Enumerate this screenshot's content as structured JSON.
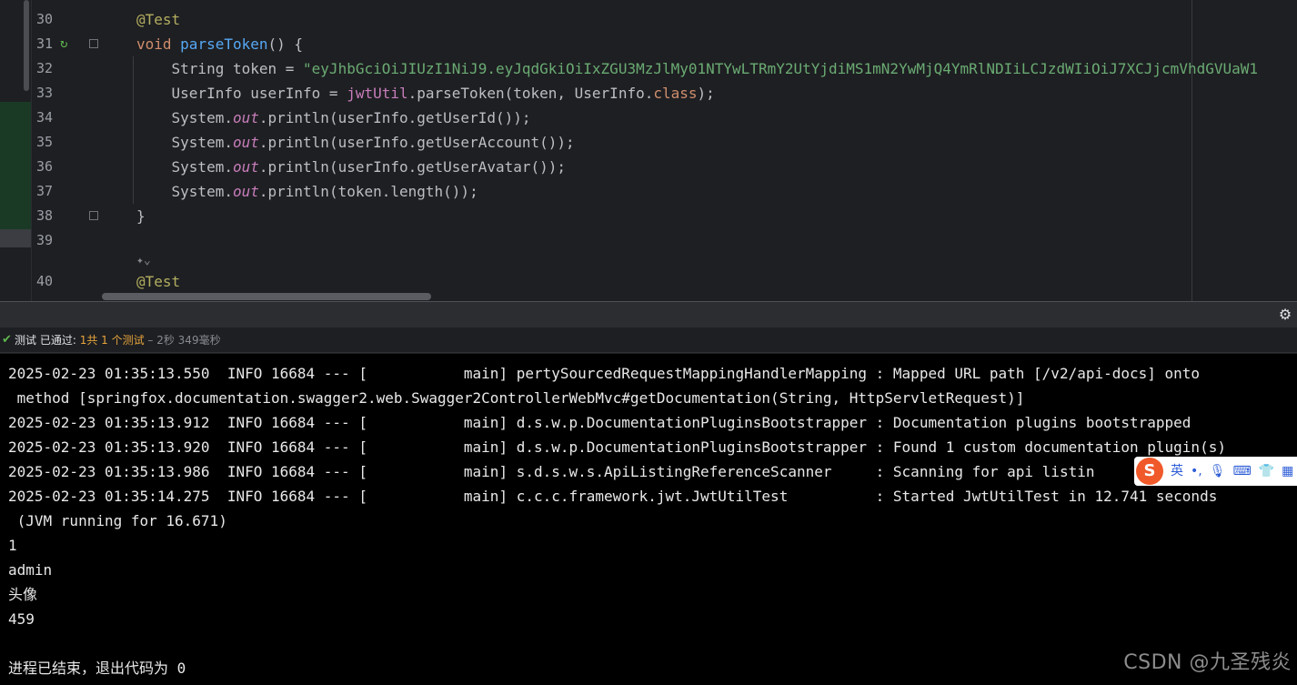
{
  "editor": {
    "line_numbers": [
      "30",
      "31",
      "32",
      "33",
      "34",
      "35",
      "36",
      "37",
      "38",
      "39",
      "40"
    ],
    "lines": [
      [
        {
          "c": "ann",
          "t": "@Test"
        }
      ],
      [
        {
          "c": "kw",
          "t": "void "
        },
        {
          "c": "fn",
          "t": "parseToken"
        },
        {
          "c": "pl",
          "t": "() {"
        }
      ],
      [
        {
          "c": "pl",
          "t": "    String token = "
        },
        {
          "c": "str",
          "t": "\"eyJhbGciOiJIUzI1NiJ9.eyJqdGkiOiIxZGU3MzJlMy01NTYwLTRmY2UtYjdiMS1mN2YwMjQ4YmRlNDIiLCJzdWIiOiJ7XCJjcmVhdGVUaW1"
        }
      ],
      [
        {
          "c": "pl",
          "t": "    UserInfo userInfo = "
        },
        {
          "c": "fld",
          "t": "jwtUtil"
        },
        {
          "c": "pl",
          "t": ".parseToken(token, UserInfo."
        },
        {
          "c": "kw",
          "t": "class"
        },
        {
          "c": "pl",
          "t": ");"
        }
      ],
      [
        {
          "c": "pl",
          "t": "    System."
        },
        {
          "c": "st",
          "t": "out"
        },
        {
          "c": "pl",
          "t": ".println(userInfo.getUserId());"
        }
      ],
      [
        {
          "c": "pl",
          "t": "    System."
        },
        {
          "c": "st",
          "t": "out"
        },
        {
          "c": "pl",
          "t": ".println(userInfo.getUserAccount());"
        }
      ],
      [
        {
          "c": "pl",
          "t": "    System."
        },
        {
          "c": "st",
          "t": "out"
        },
        {
          "c": "pl",
          "t": ".println(userInfo.getUserAvatar());"
        }
      ],
      [
        {
          "c": "pl",
          "t": "    System."
        },
        {
          "c": "st",
          "t": "out"
        },
        {
          "c": "pl",
          "t": ".println(token.length());"
        }
      ],
      [
        {
          "c": "pl",
          "t": "}"
        }
      ],
      [],
      [
        {
          "c": "ann",
          "t": "@Test"
        }
      ]
    ],
    "lens_hint": "✦⌄"
  },
  "toolbar": {
    "settings_icon": "⚙"
  },
  "status": {
    "check_icon": "✔",
    "label": "测试 已通过: ",
    "passed": "1",
    "total": "共 1 个测试",
    "duration": " – 2秒 349毫秒"
  },
  "console": {
    "lines": [
      "2025-02-23 01:35:13.550  INFO 16684 --- [           main] pertySourcedRequestMappingHandlerMapping : Mapped URL path [/v2/api-docs] onto",
      " method [springfox.documentation.swagger2.web.Swagger2ControllerWebMvc#getDocumentation(String, HttpServletRequest)]",
      "2025-02-23 01:35:13.912  INFO 16684 --- [           main] d.s.w.p.DocumentationPluginsBootstrapper : Documentation plugins bootstrapped",
      "2025-02-23 01:35:13.920  INFO 16684 --- [           main] d.s.w.p.DocumentationPluginsBootstrapper : Found 1 custom documentation plugin(s)",
      "2025-02-23 01:35:13.986  INFO 16684 --- [           main] s.d.s.w.s.ApiListingReferenceScanner     : Scanning for api listin",
      "2025-02-23 01:35:14.275  INFO 16684 --- [           main] c.c.c.framework.jwt.JwtUtilTest          : Started JwtUtilTest in 12.741 seconds",
      " (JVM running for 16.671)",
      "1",
      "admin",
      "头像",
      "459",
      "",
      "进程已结束，退出代码为 0"
    ]
  },
  "ime": {
    "logo": "S",
    "items": [
      "英",
      "•,",
      "🎙",
      "⌨",
      "👕",
      "▦"
    ]
  },
  "watermark": "CSDN @九圣残炎",
  "colors": {
    "editor_bg": "#1e1f22",
    "console_bg": "#000000",
    "annotation": "#b3ae60",
    "keyword": "#cf8e6d",
    "method": "#56a8f5",
    "string": "#6aab73",
    "field": "#c77dbb",
    "pass_green": "#5fb84f",
    "count_orange": "#e5a33c"
  }
}
